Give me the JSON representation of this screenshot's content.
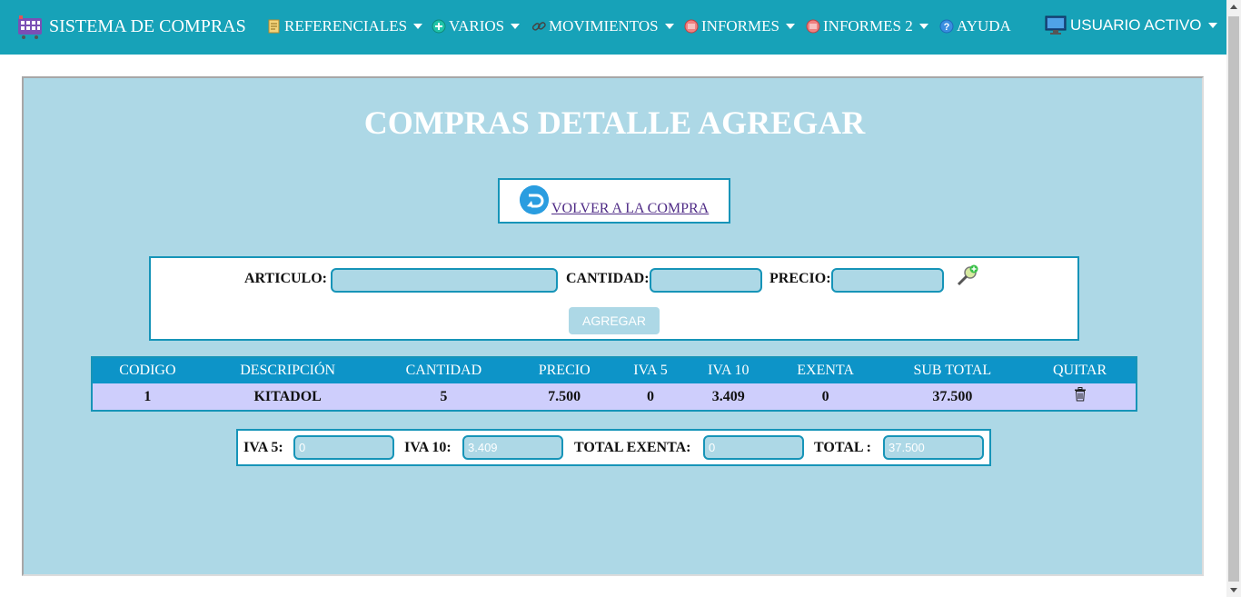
{
  "app": {
    "title": "SISTEMA DE COMPRAS"
  },
  "nav": {
    "items": [
      {
        "label": "REFERENCIALES",
        "icon": "document-icon"
      },
      {
        "label": "VARIOS",
        "icon": "plus-circle-icon"
      },
      {
        "label": "MOVIMIENTOS",
        "icon": "link-icon"
      },
      {
        "label": "INFORMES",
        "icon": "report-icon"
      },
      {
        "label": "INFORMES 2",
        "icon": "report-icon"
      },
      {
        "label": "AYUDA",
        "icon": "help-icon"
      }
    ],
    "user": {
      "label": "USUARIO ACTIVO",
      "icon": "monitor-icon"
    }
  },
  "page": {
    "title": "COMPRAS DETALLE AGREGAR",
    "back_link": "VOLVER A LA COMPRA"
  },
  "form": {
    "articulo_label": "ARTICULO:",
    "articulo_value": "",
    "cantidad_label": "CANTIDAD:",
    "cantidad_value": "",
    "precio_label": "PRECIO:",
    "precio_value": "",
    "add_button": "AGREGAR"
  },
  "table": {
    "headers": [
      "CODIGO",
      "DESCRIPCIÓN",
      "CANTIDAD",
      "PRECIO",
      "IVA 5",
      "IVA 10",
      "EXENTA",
      "SUB TOTAL",
      "QUITAR"
    ],
    "rows": [
      [
        "1",
        "KITADOL",
        "5",
        "7.500",
        "0",
        "3.409",
        "0",
        "37.500"
      ]
    ]
  },
  "totals": {
    "iva5_label": "IVA 5:",
    "iva5_value": "0",
    "iva10_label": "IVA 10:",
    "iva10_value": "3.409",
    "exenta_label": "TOTAL EXENTA:",
    "exenta_value": "0",
    "total_label": "TOTAL :",
    "total_value": "37.500"
  },
  "colors": {
    "navbar": "#17a2b8",
    "panel": "#add8e6",
    "border": "#1694b8",
    "table_header": "#0d94c8",
    "table_row": "#cecefc"
  }
}
